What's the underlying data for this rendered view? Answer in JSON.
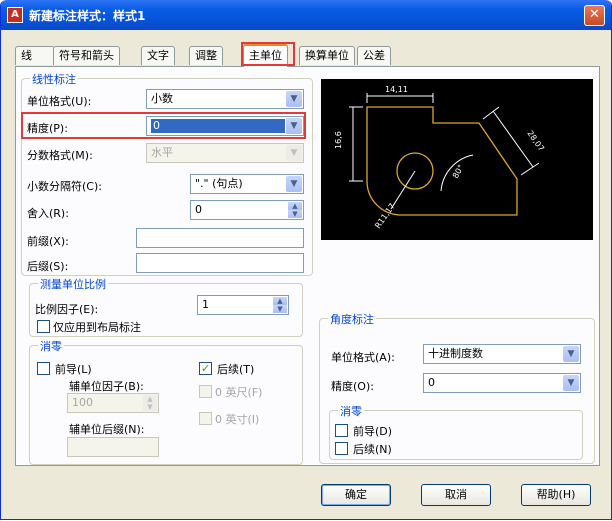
{
  "window": {
    "title": "新建标注样式：样式1",
    "close": "✕",
    "app_icon": "A"
  },
  "tabs": [
    "线",
    "符号和箭头",
    "文字",
    "调整",
    "主单位",
    "换算单位",
    "公差"
  ],
  "linear": {
    "title": "线性标注",
    "unit_format_label": "单位格式(U):",
    "unit_format_value": "小数",
    "precision_label": "精度(P):",
    "precision_value": "0",
    "fraction_label": "分数格式(M):",
    "fraction_value": "水平",
    "decimal_sep_label": "小数分隔符(C):",
    "decimal_sep_value": "\".\" (句点)",
    "round_label": "舍入(R):",
    "round_value": "0",
    "prefix_label": "前缀(X):",
    "suffix_label": "后缀(S):"
  },
  "scale": {
    "title": "测量单位比例",
    "factor_label": "比例因子(E):",
    "factor_value": "1",
    "layout_only_label": "仅应用到布局标注"
  },
  "zero": {
    "title": "消零",
    "leading_label": "前导(L)",
    "trailing_label": "后续(T)",
    "sub_factor_label": "辅单位因子(B):",
    "sub_factor_value": "100",
    "sub_suffix_label": "辅单位后缀(N):",
    "feet_label": "0 英尺(F)",
    "inch_label": "0 英寸(I)"
  },
  "angular": {
    "title": "角度标注",
    "unit_format_label": "单位格式(A):",
    "unit_format_value": "十进制度数",
    "precision_label": "精度(O):",
    "precision_value": "0",
    "zero_title": "消零",
    "leading_label": "前导(D)",
    "trailing_label": "后续(N)"
  },
  "preview": {
    "dim_top": "14,11",
    "dim_left": "16,6",
    "dim_right": "28,07",
    "dim_angle": "80°",
    "dim_radius": "R11,17"
  },
  "buttons": {
    "ok": "确定",
    "cancel": "取消",
    "help": "帮助(H)"
  },
  "icons": {
    "dropdown": "▼",
    "up": "▲",
    "down": "▼",
    "check": "✓"
  }
}
